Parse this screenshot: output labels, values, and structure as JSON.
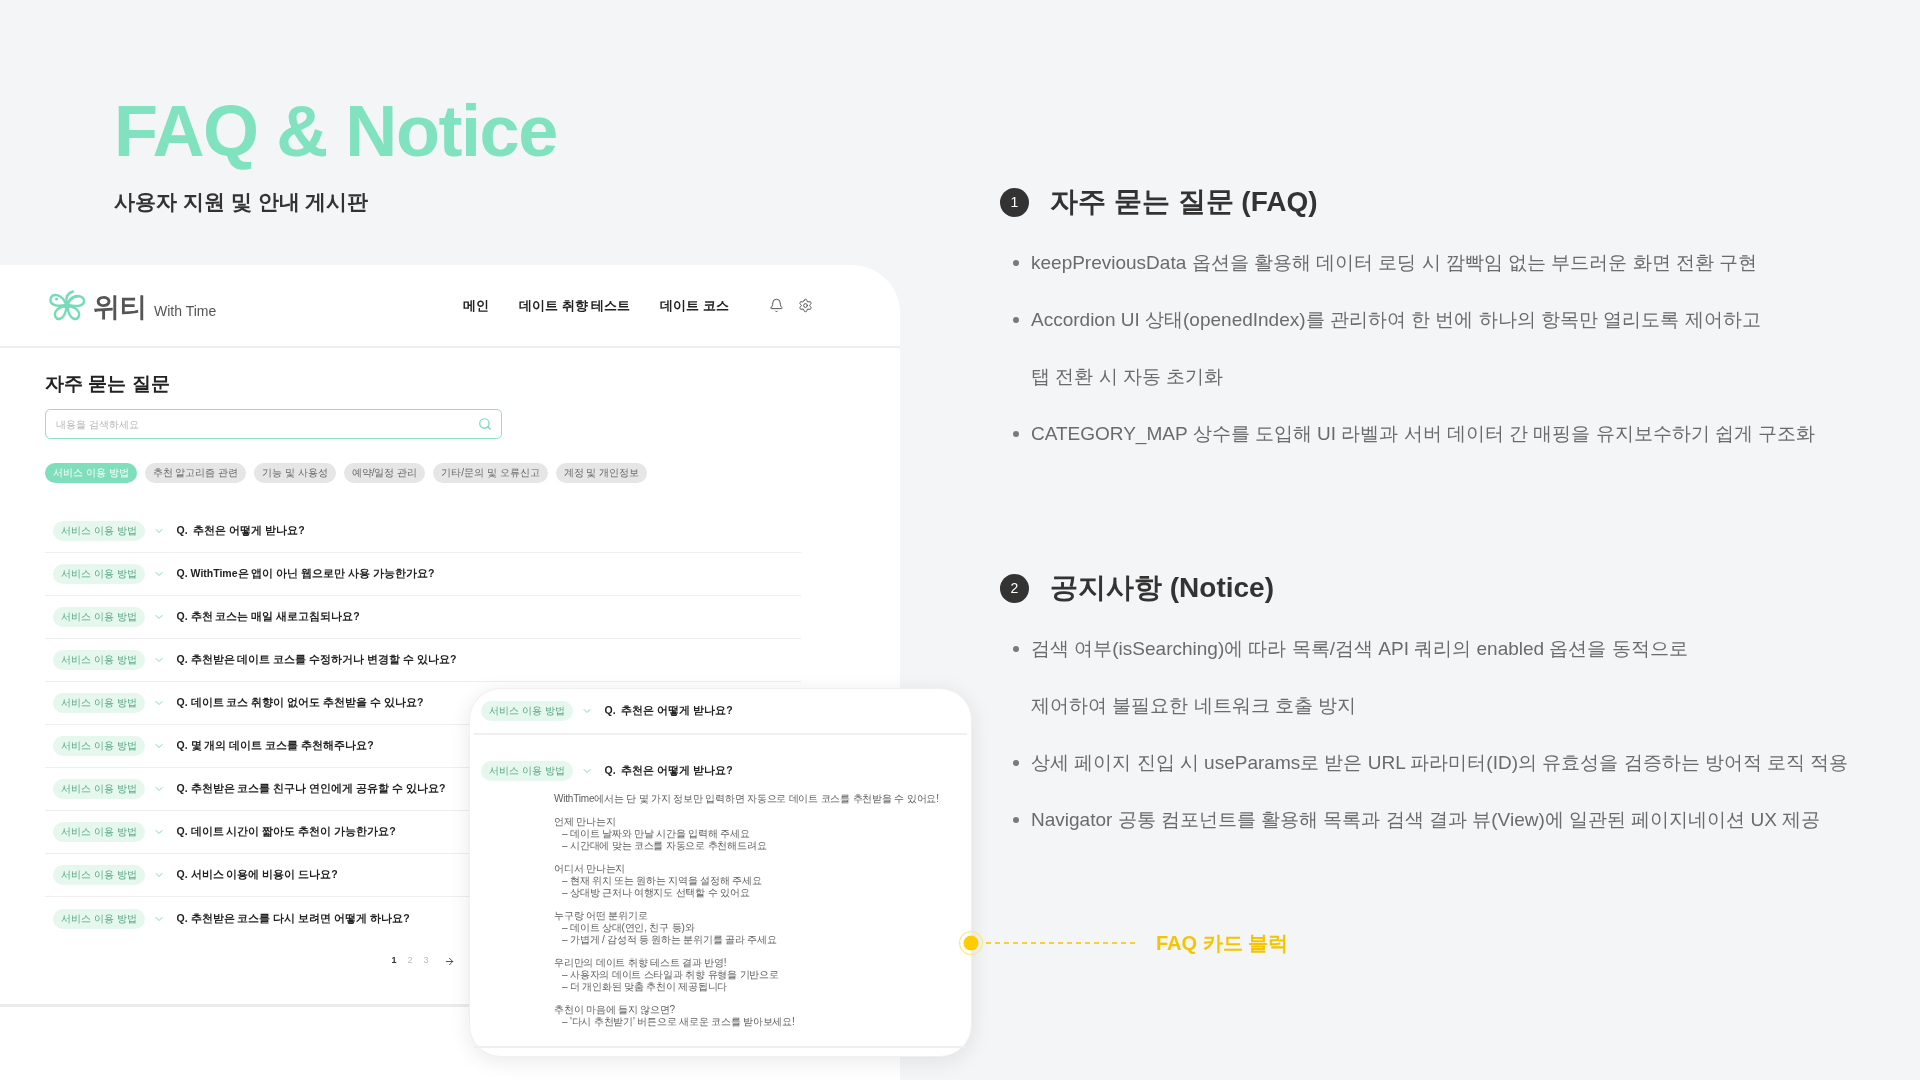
{
  "hero": {
    "title": "FAQ & Notice",
    "subtitle": "사용자 지원 및 안내 게시판"
  },
  "mockup": {
    "logo": {
      "name": "위티",
      "tagline": "With Time"
    },
    "nav": [
      "메인",
      "데이트 취향 테스트",
      "데이트 코스"
    ],
    "page_title": "자주 묻는 질문",
    "search": {
      "placeholder": "내용을 검색하세요"
    },
    "categories": [
      {
        "label": "서비스 이용 방법",
        "selected": true
      },
      {
        "label": "추천 알고리즘 관련",
        "selected": false
      },
      {
        "label": "기능 및 사용성",
        "selected": false
      },
      {
        "label": "예약/일정 관리",
        "selected": false
      },
      {
        "label": "기타/문의 및 오류신고",
        "selected": false
      },
      {
        "label": "계정 및 개인정보",
        "selected": false
      }
    ],
    "faq_rows": [
      {
        "category": "서비스 이용 방법",
        "question": "Q.  추천은 어떻게 받나요?"
      },
      {
        "category": "서비스 이용 방법",
        "question": "Q. WithTime은 앱이 아닌 웹으로만 사용 가능한가요?"
      },
      {
        "category": "서비스 이용 방법",
        "question": "Q. 추천 코스는 매일 새로고침되나요?"
      },
      {
        "category": "서비스 이용 방법",
        "question": "Q. 추천받은 데이트 코스를 수정하거나 변경할 수 있나요?"
      },
      {
        "category": "서비스 이용 방법",
        "question": "Q. 데이트 코스 취향이 없어도 추천받을 수 있나요?"
      },
      {
        "category": "서비스 이용 방법",
        "question": "Q. 몇 개의 데이트 코스를 추천해주나요?"
      },
      {
        "category": "서비스 이용 방법",
        "question": "Q. 추천받은 코스를 친구나 연인에게 공유할 수 있나요?"
      },
      {
        "category": "서비스 이용 방법",
        "question": "Q. 데이트 시간이 짧아도 추천이 가능한가요?"
      },
      {
        "category": "서비스 이용 방법",
        "question": "Q. 서비스 이용에 비용이 드나요?"
      },
      {
        "category": "서비스 이용 방법",
        "question": "Q. 추천받은 코스를 다시 보려면 어떻게 하나요?"
      }
    ],
    "pagination": [
      {
        "label": "1",
        "selected": true
      },
      {
        "label": "2",
        "selected": false
      },
      {
        "label": "3",
        "selected": false
      }
    ]
  },
  "faq_card": {
    "rows": [
      {
        "category": "서비스 이용 방법",
        "question": "Q.  추천은 어떻게 받나요?"
      },
      {
        "category": "서비스 이용 방법",
        "question": "Q.  추천은 어떻게 받나요?",
        "answer": {
          "intro": "WithTime에서는 단 몇 가지 정보만 입력하면 자동으로 데이트 코스를 추천받을 수 있어요!",
          "groups": [
            {
              "heading": "언제 만나는지",
              "items": [
                "– 데이트 날짜와 만날 시간을 입력해 주세요",
                "– 시간대에 맞는 코스를 자동으로 추천해드려요"
              ]
            },
            {
              "heading": "어디서 만나는지",
              "items": [
                "– 현재 위치 또는 원하는 지역을 설정해 주세요",
                "– 상대방 근처나 여행지도 선택할 수 있어요"
              ]
            },
            {
              "heading": "누구랑 어떤 분위기로",
              "items": [
                "– 데이트 상대(연인, 친구 등)와",
                "– 가볍게 / 감성적 등 원하는 분위기를 골라 주세요"
              ]
            },
            {
              "heading": "우리만의 데이트 취향 테스트 결과 반영!",
              "items": [
                "– 사용자의 데이트 스타일과 취향 유형을 기반으로",
                "– 더 개인화된 맞춤 추천이 제공됩니다"
              ]
            },
            {
              "heading": "추천이 마음에 들지 않으면?",
              "items": [
                "– '다시 추천받기' 버튼으로 새로운 코스를 받아보세요!"
              ]
            }
          ]
        }
      }
    ]
  },
  "callout": {
    "label": "FAQ 카드 블럭"
  },
  "sections": [
    {
      "number": "1",
      "title": "자주 묻는 질문 (FAQ)",
      "bullets": [
        {
          "lines": [
            "keepPreviousData 옵션을 활용해 데이터 로딩 시 깜빡임 없는 부드러운 화면 전환 구현"
          ]
        },
        {
          "lines": [
            "Accordion UI 상태(openedIndex)를 관리하여 한 번에 하나의 항목만 열리도록 제어하고",
            "탭 전환 시 자동 초기화"
          ]
        },
        {
          "lines": [
            "CATEGORY_MAP 상수를 도입해 UI 라벨과 서버 데이터 간 매핑을 유지보수하기 쉽게 구조화"
          ]
        }
      ]
    },
    {
      "number": "2",
      "title": "공지사항 (Notice)",
      "bullets": [
        {
          "lines": [
            "검색 여부(isSearching)에 따라 목록/검색 API 쿼리의 enabled 옵션을 동적으로",
            "제어하여 불필요한 네트워크 호출 방지"
          ]
        },
        {
          "lines": [
            "상세 페이지 진입 시 useParams로 받은 URL 파라미터(ID)의 유효성을 검증하는 방어적 로직 적용"
          ]
        },
        {
          "lines": [
            "Navigator 공통 컴포넌트를 활용해 목록과 검색 결과 뷰(View)에 일관된 페이지네이션 UX 제공"
          ]
        }
      ]
    }
  ]
}
